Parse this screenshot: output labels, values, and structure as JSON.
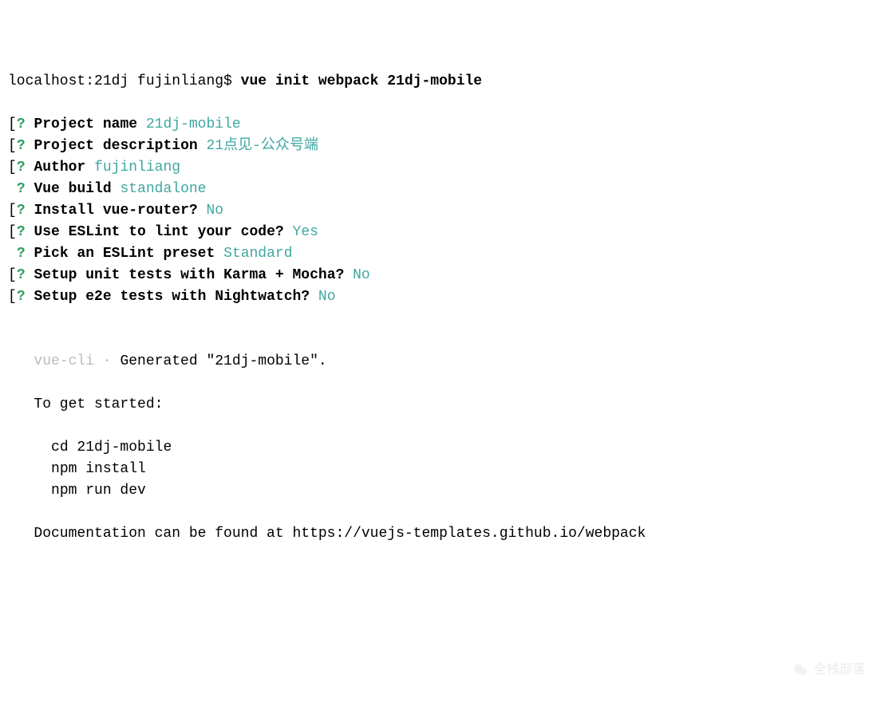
{
  "prompt": {
    "text": "localhost:21dj fujinliang$ ",
    "command": "vue init webpack 21dj-mobile"
  },
  "questions": [
    {
      "prefix": "[",
      "q": "?",
      "label": "Project name",
      "answer": "21dj-mobile"
    },
    {
      "prefix": "[",
      "q": "?",
      "label": "Project description",
      "answer": "21点见-公众号端"
    },
    {
      "prefix": "[",
      "q": "?",
      "label": "Author",
      "answer": "fujinliang"
    },
    {
      "prefix": " ",
      "q": "?",
      "label": "Vue build",
      "answer": "standalone"
    },
    {
      "prefix": "[",
      "q": "?",
      "label": "Install vue-router?",
      "answer": "No"
    },
    {
      "prefix": "[",
      "q": "?",
      "label": "Use ESLint to lint your code?",
      "answer": "Yes"
    },
    {
      "prefix": " ",
      "q": "?",
      "label": "Pick an ESLint preset",
      "answer": "Standard"
    },
    {
      "prefix": "[",
      "q": "?",
      "label": "Setup unit tests with Karma + Mocha?",
      "answer": "No"
    },
    {
      "prefix": "[",
      "q": "?",
      "label": "Setup e2e tests with Nightwatch?",
      "answer": "No"
    }
  ],
  "generated": {
    "cli": "vue-cli",
    "dot": " · ",
    "msg": "Generated \"21dj-mobile\"."
  },
  "instructions": {
    "header": "To get started:",
    "lines": [
      "cd 21dj-mobile",
      "npm install",
      "npm run dev"
    ],
    "docs": "Documentation can be found at https://vuejs-templates.github.io/webpack"
  },
  "watermark": "全栈部落"
}
